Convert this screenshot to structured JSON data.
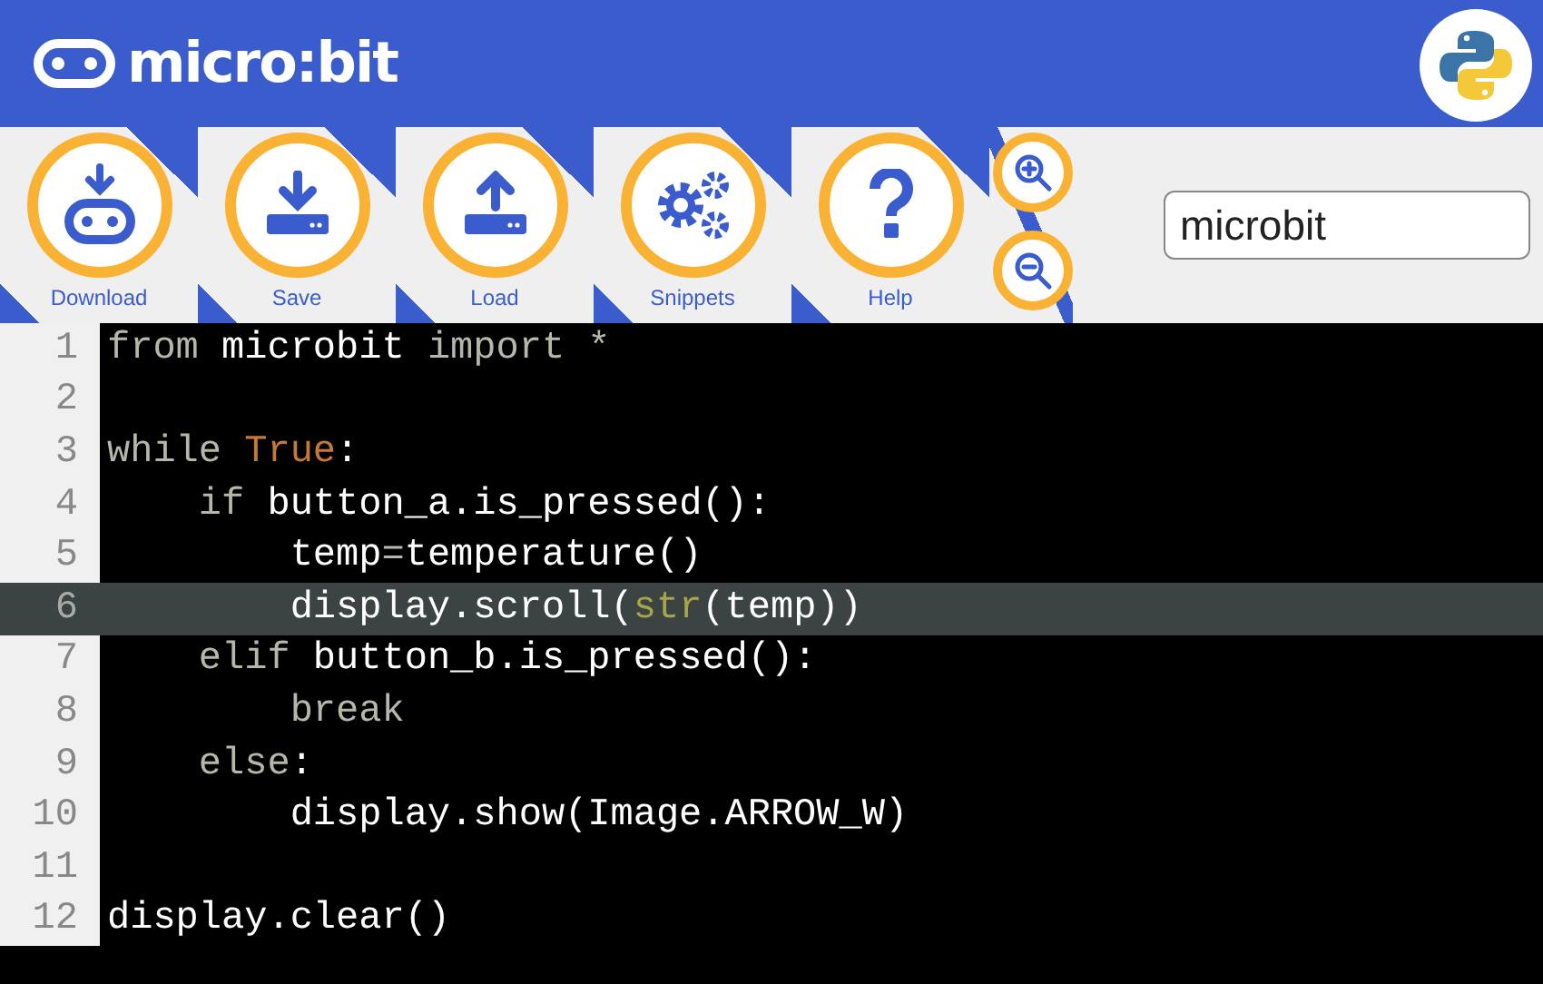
{
  "header": {
    "logo_text": "micro:bit"
  },
  "toolbar": {
    "buttons": [
      {
        "label": "Download"
      },
      {
        "label": "Save"
      },
      {
        "label": "Load"
      },
      {
        "label": "Snippets"
      },
      {
        "label": "Help"
      }
    ],
    "script_name": {
      "value": "microbit"
    }
  },
  "editor": {
    "lines": [
      {
        "number": "1",
        "active": false,
        "tokens": [
          {
            "kind": "keyword",
            "text": "from"
          },
          {
            "kind": "name",
            "text": " microbit"
          },
          {
            "kind": "keyword",
            "text": " import"
          },
          {
            "kind": "operator",
            "text": " *"
          }
        ]
      },
      {
        "number": "2",
        "active": false
      },
      {
        "number": "3",
        "active": false,
        "tokens": [
          {
            "kind": "keyword",
            "text": "while"
          },
          {
            "kind": "constant",
            "text": " True"
          },
          {
            "kind": "name",
            "text": ":"
          }
        ]
      },
      {
        "number": "4",
        "active": false,
        "tokens": [
          {
            "kind": "keyword",
            "text": "    if"
          },
          {
            "kind": "name",
            "text": " button_a.is_pressed():"
          }
        ]
      },
      {
        "number": "5",
        "active": false,
        "tokens": [
          {
            "kind": "name",
            "text": "        temp"
          },
          {
            "kind": "operator",
            "text": "="
          },
          {
            "kind": "name",
            "text": "temperature()"
          }
        ]
      },
      {
        "number": "6",
        "active": true,
        "tokens": [
          {
            "kind": "name",
            "text": "        display.scroll("
          },
          {
            "kind": "builtin",
            "text": "str"
          },
          {
            "kind": "name",
            "text": "(temp))"
          }
        ]
      },
      {
        "number": "7",
        "active": false,
        "tokens": [
          {
            "kind": "keyword",
            "text": "    elif"
          },
          {
            "kind": "name",
            "text": " button_b.is_pressed():"
          }
        ]
      },
      {
        "number": "8",
        "active": false,
        "tokens": [
          {
            "kind": "keyword",
            "text": "        break"
          }
        ]
      },
      {
        "number": "9",
        "active": false,
        "tokens": [
          {
            "kind": "keyword",
            "text": "    else"
          },
          {
            "kind": "name",
            "text": ":"
          }
        ]
      },
      {
        "number": "10",
        "active": false,
        "tokens": [
          {
            "kind": "name",
            "text": "        display.show(Image.ARROW_W)"
          }
        ]
      },
      {
        "number": "11",
        "active": false
      },
      {
        "number": "12",
        "active": false,
        "tokens": [
          {
            "kind": "name",
            "text": "display.clear()"
          }
        ]
      }
    ]
  }
}
